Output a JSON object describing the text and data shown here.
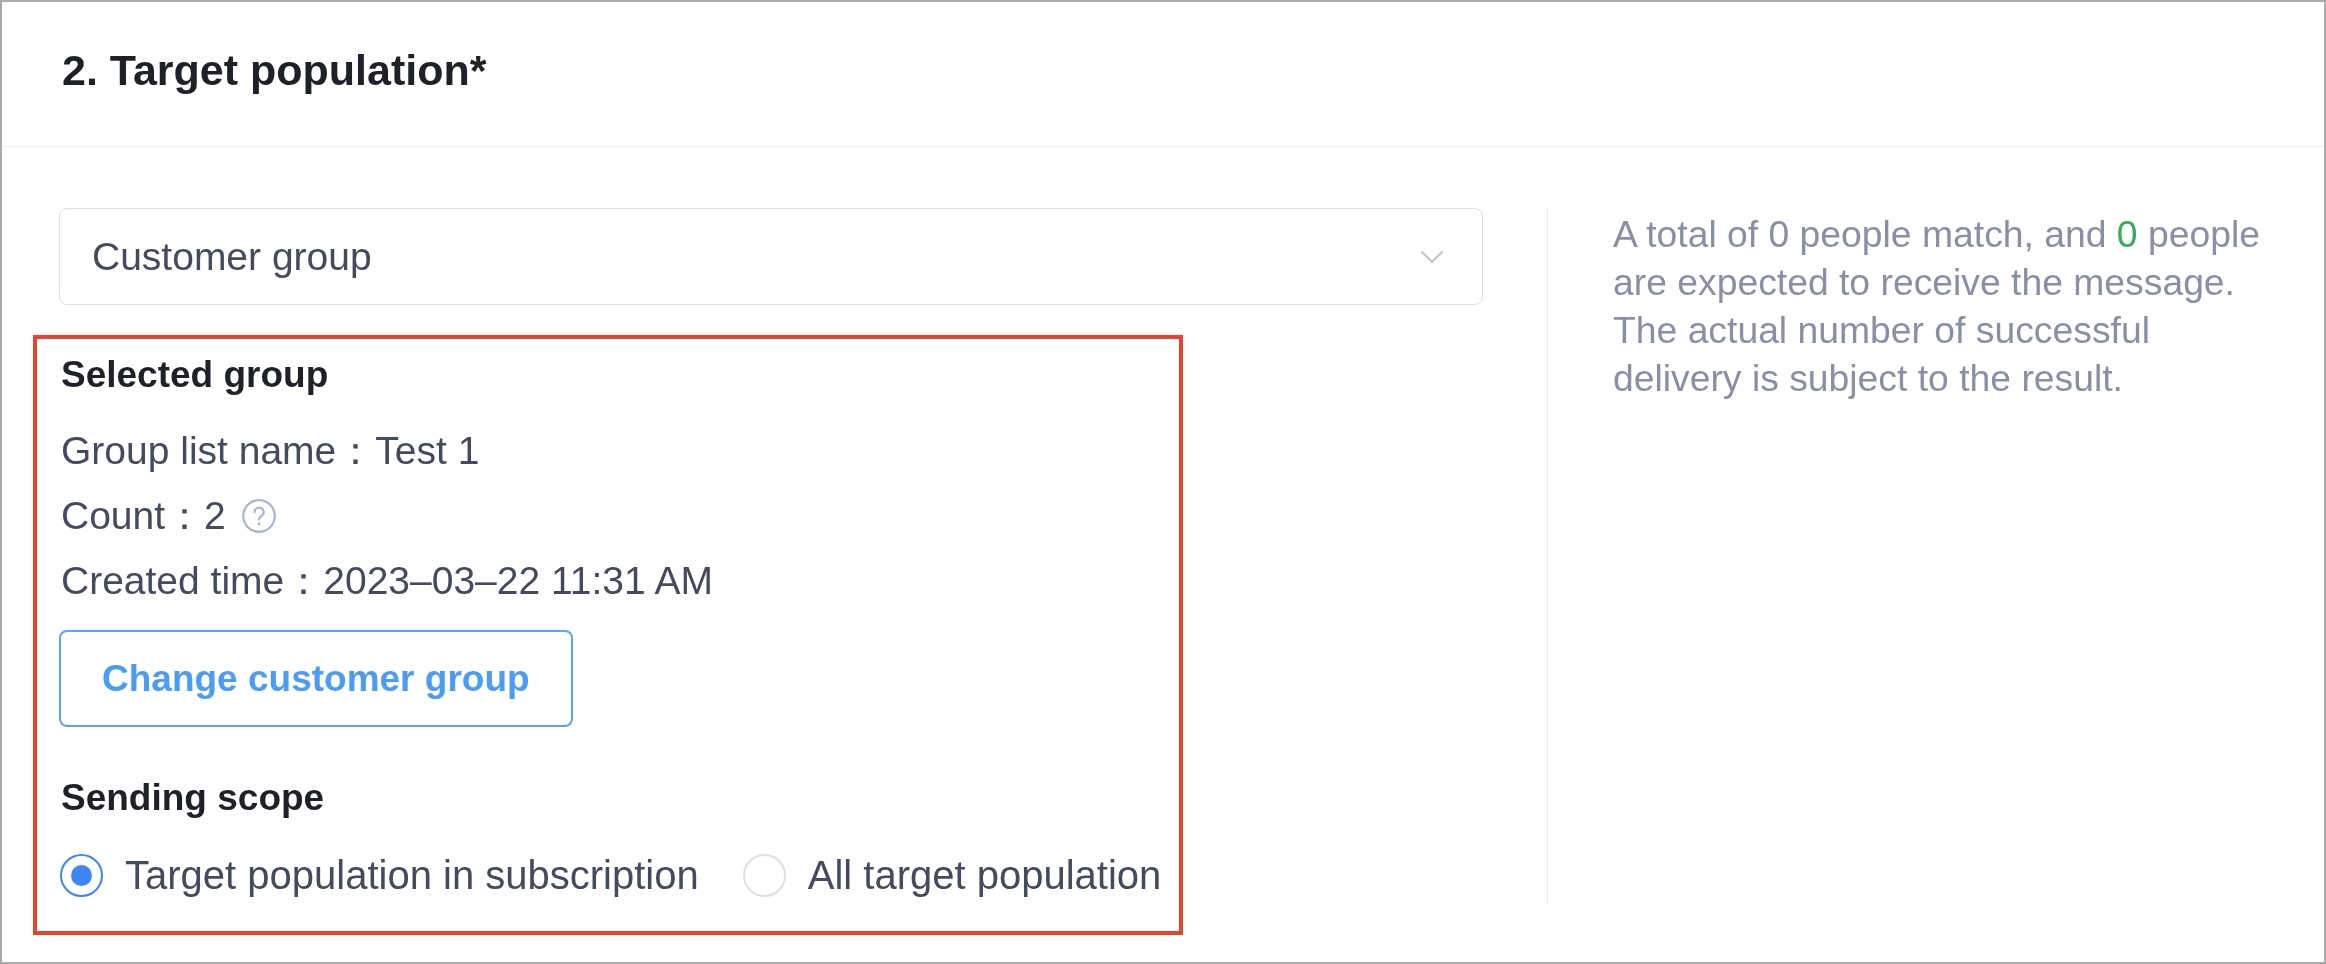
{
  "section": {
    "title": "2. Target population*"
  },
  "audience_select": {
    "value": "Customer group"
  },
  "selected_group": {
    "highlighted": true,
    "heading": "Selected group",
    "details": [
      {
        "text": "Group list name：Test 1",
        "help": false
      },
      {
        "text": "Count：2",
        "help": true
      },
      {
        "text": "Created time：2023–03–22 11:31 AM",
        "help": false
      }
    ],
    "change_button": "Change customer group"
  },
  "sending_scope": {
    "heading": "Sending scope",
    "options": [
      {
        "label": "Target population in subscription",
        "selected": true
      },
      {
        "label": "All target population",
        "selected": false
      }
    ]
  },
  "summary": {
    "segments": [
      {
        "kind": "plain",
        "text": "A total of 0 people match, and "
      },
      {
        "kind": "highlight",
        "text": "0"
      },
      {
        "kind": "plain",
        "text": " people are expected to receive the message. The actual number of successful delivery is subject to the result."
      }
    ]
  }
}
